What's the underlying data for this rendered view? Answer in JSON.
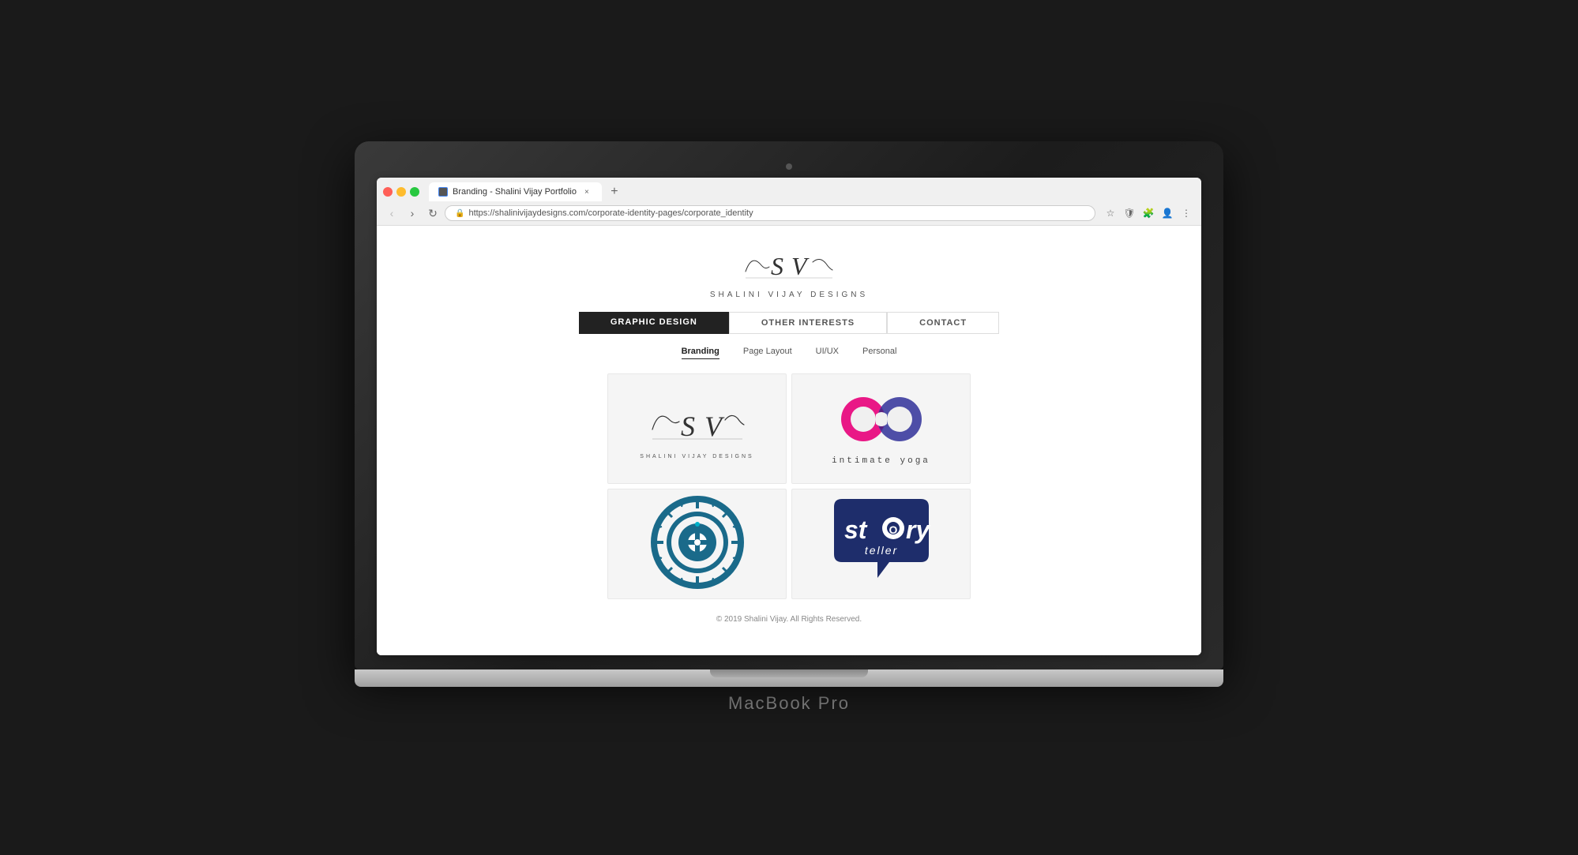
{
  "browser": {
    "tab_title": "Branding - Shalini Vijay Portfolio",
    "url": "https://shalinivijaydesigns.com/corporate-identity-pages/corporate_identity",
    "new_tab_symbol": "+",
    "close_symbol": "×",
    "back_symbol": "‹",
    "forward_symbol": "›",
    "refresh_symbol": "↻"
  },
  "site": {
    "logo_text": "SV",
    "brand_name": "SHALINI VIJAY DESIGNS"
  },
  "nav": {
    "items": [
      {
        "label": "GRAPHIC DESIGN",
        "active": true
      },
      {
        "label": "OTHER INTERESTS",
        "active": false
      },
      {
        "label": "CONTACT",
        "active": false
      }
    ]
  },
  "sub_nav": {
    "items": [
      {
        "label": "Branding",
        "active": true
      },
      {
        "label": "Page Layout",
        "active": false
      },
      {
        "label": "UI/UX",
        "active": false
      },
      {
        "label": "Personal",
        "active": false
      }
    ]
  },
  "portfolio": {
    "items": [
      {
        "id": "sv-logo",
        "title": "Shalini Vijay Designs Logo",
        "type": "script-logo"
      },
      {
        "id": "intimate-yoga",
        "title": "CO intimate yoga",
        "type": "infinity-logo",
        "text": "intimate yoga"
      },
      {
        "id": "target-logo",
        "title": "Target/Crosshair Logo",
        "type": "target-logo"
      },
      {
        "id": "storyteller",
        "title": "Story Teller",
        "type": "story-logo",
        "line1": "story",
        "line2": "teller"
      }
    ]
  },
  "footer": {
    "copyright": "© 2019 Shalini Vijay. All Rights Reserved."
  },
  "macbook": {
    "model": "MacBook Pro"
  }
}
